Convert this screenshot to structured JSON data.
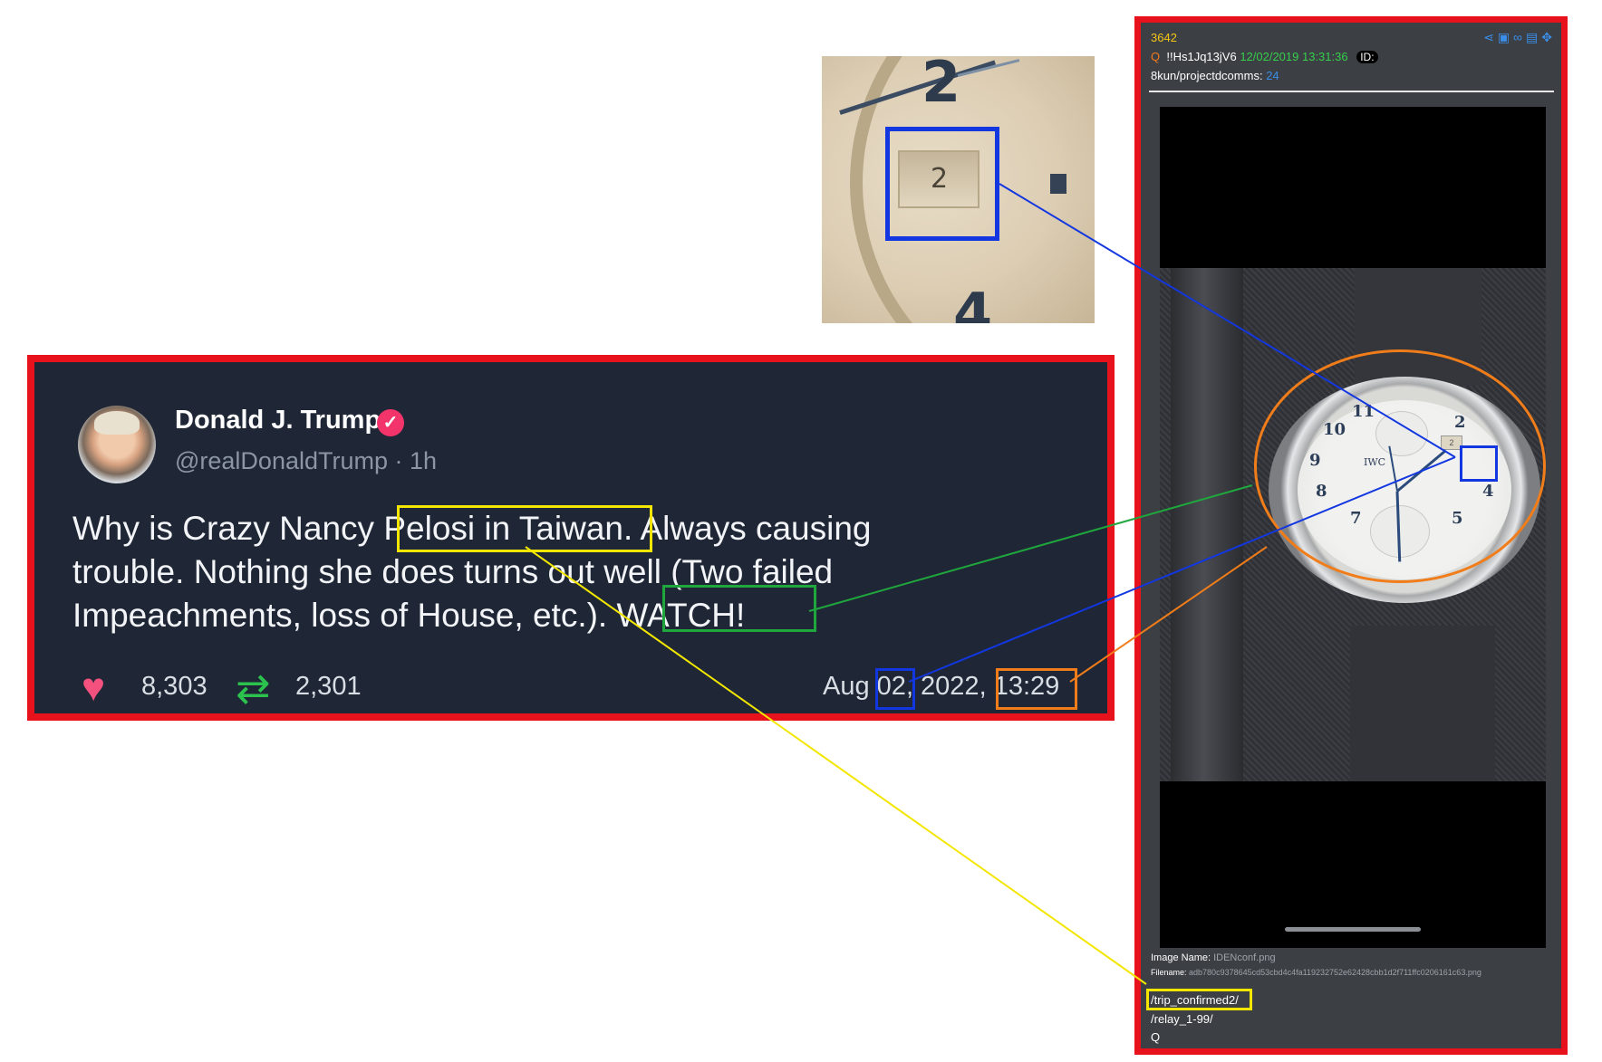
{
  "zoom_crop": {
    "digits": [
      "2",
      "4"
    ],
    "date_window_digit": "2"
  },
  "tweet": {
    "name": "Donald J. Trump",
    "verified_icon": "verified-badge-icon",
    "handle": "@realDonaldTrump · 1h",
    "text_pre": "Why is Crazy Nancy ",
    "text_pelosi": "Pelosi in Taiwan.",
    "text_mid": " Always causing\ntrouble. Nothing she does turns out well (Two failed\nImpeachments, loss of House, etc.). ",
    "text_watch": "WATCH!",
    "likes": "8,303",
    "retweets": "2,301",
    "date_month": "Aug ",
    "date_day": "02",
    "date_year": ", 2022, ",
    "date_time": "13:29"
  },
  "qpost": {
    "post_number": "3642",
    "q_letter": "Q",
    "tripcode": "!!Hs1Jq13jV6",
    "datetime": "12/02/2019 13:31:36",
    "id_label": "ID:",
    "board": "8kun/projectdcomms:",
    "board_count": "24",
    "icons": [
      "share-icon",
      "clipboard-icon",
      "glasses-icon",
      "document-icon",
      "move-icon"
    ],
    "watch_brand": "IWC",
    "dial_numbers": [
      "10",
      "11",
      "2",
      "9",
      "8",
      "4",
      "7",
      "5"
    ],
    "date_window": "2",
    "image_name_label": "Image Name:",
    "image_name": "IDENconf.png",
    "filename_label": "Filename:",
    "filename": "adb780c9378645cd53cbd4c4fa119232752e62428cbb1d2f711ffc0206161c63.png",
    "line1": "/trip_confirmed2/",
    "line2": "/relay_1-99/",
    "line3": "Q"
  },
  "colors": {
    "frame_red": "#e8121c",
    "highlight_yellow": "#f3e600",
    "highlight_green": "#1fa63c",
    "highlight_blue": "#1237e0",
    "highlight_orange": "#f07d1a",
    "tweet_bg": "#1f2736",
    "qpost_bg": "#3c3f44"
  }
}
